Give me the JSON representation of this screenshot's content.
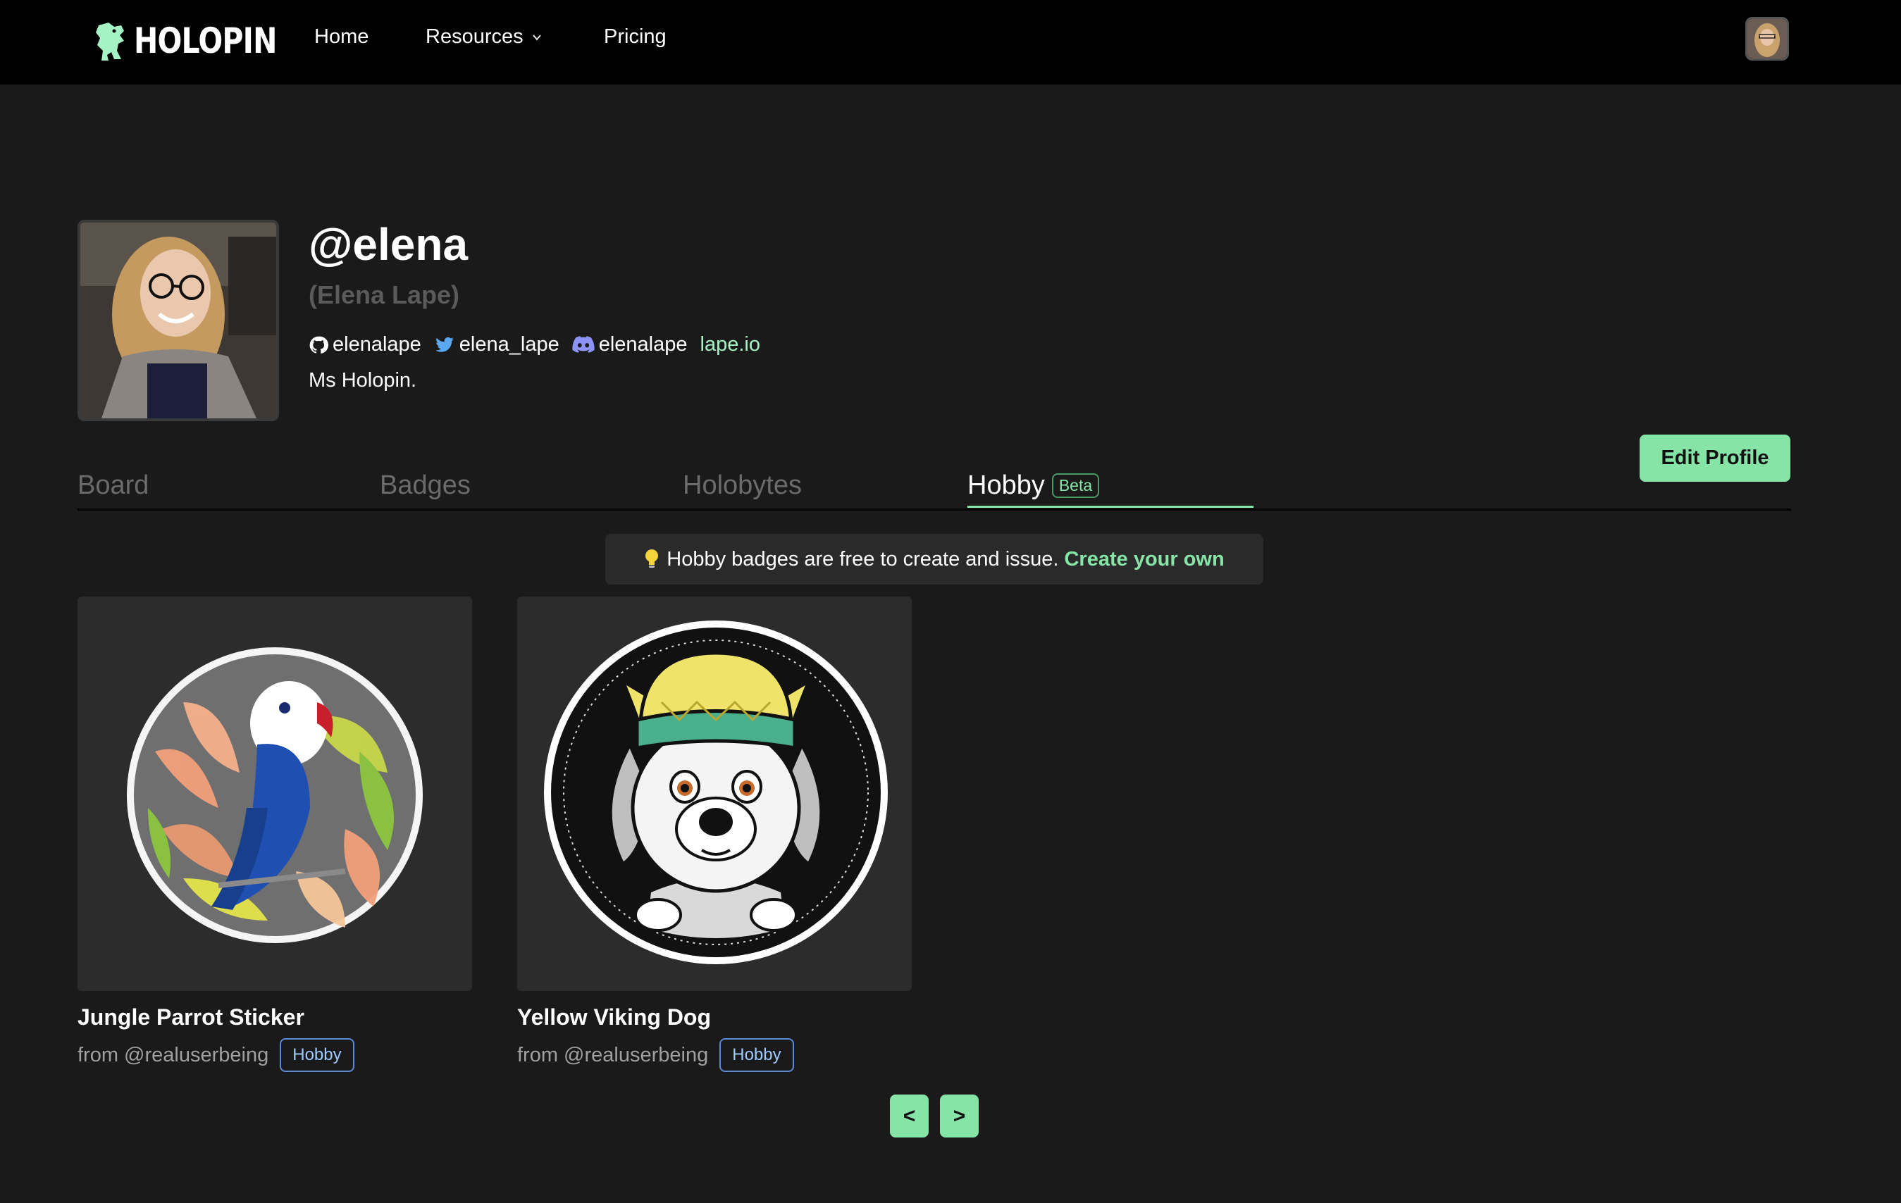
{
  "nav": {
    "logo_text": "HOLOPIN",
    "links": {
      "home": "Home",
      "resources": "Resources",
      "pricing": "Pricing"
    }
  },
  "profile": {
    "handle": "@elena",
    "full_name": "(Elena Lape)",
    "github": "elenalape",
    "twitter": "elena_lape",
    "discord": "elenalape",
    "website": "lape.io",
    "bio": "Ms Holopin.",
    "edit_label": "Edit Profile"
  },
  "tabs": {
    "board": "Board",
    "badges": "Badges",
    "holobytes": "Holobytes",
    "hobby": "Hobby",
    "hobby_tag": "Beta"
  },
  "notice": {
    "text": "Hobby badges are free to create and issue.",
    "link": "Create your own"
  },
  "badges": [
    {
      "name": "Jungle Parrot Sticker",
      "from": "from @realuserbeing",
      "tag": "Hobby"
    },
    {
      "name": "Yellow Viking Dog",
      "from": "from @realuserbeing",
      "tag": "Hobby"
    }
  ],
  "pagination": {
    "prev": "<",
    "next": ">"
  },
  "colors": {
    "accent": "#86e5a6",
    "background": "#1a1a1a",
    "nav": "#000000",
    "tag_blue": "#9ec9ff"
  }
}
